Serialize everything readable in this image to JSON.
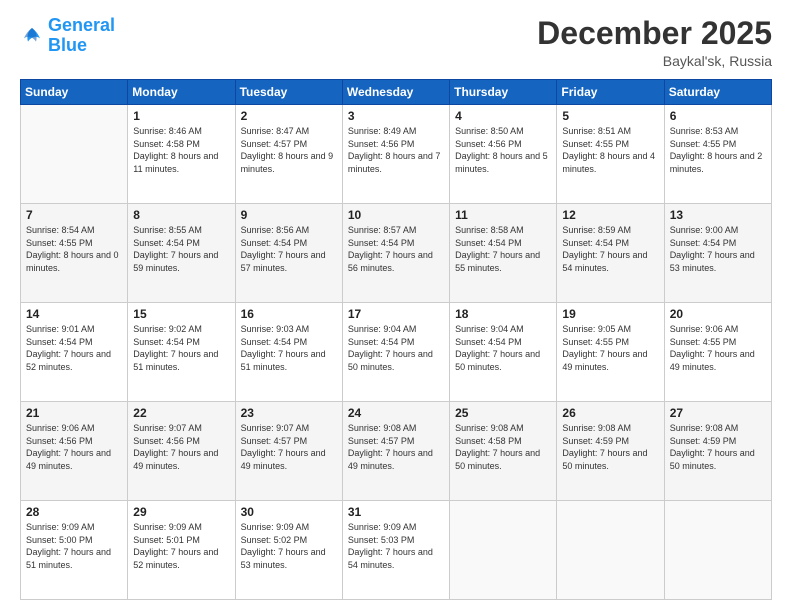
{
  "logo": {
    "line1": "General",
    "line2": "Blue"
  },
  "title": "December 2025",
  "location": "Baykal'sk, Russia",
  "days_of_week": [
    "Sunday",
    "Monday",
    "Tuesday",
    "Wednesday",
    "Thursday",
    "Friday",
    "Saturday"
  ],
  "weeks": [
    [
      {
        "day": "",
        "sunrise": "",
        "sunset": "",
        "daylight": ""
      },
      {
        "day": "1",
        "sunrise": "Sunrise: 8:46 AM",
        "sunset": "Sunset: 4:58 PM",
        "daylight": "Daylight: 8 hours and 11 minutes."
      },
      {
        "day": "2",
        "sunrise": "Sunrise: 8:47 AM",
        "sunset": "Sunset: 4:57 PM",
        "daylight": "Daylight: 8 hours and 9 minutes."
      },
      {
        "day": "3",
        "sunrise": "Sunrise: 8:49 AM",
        "sunset": "Sunset: 4:56 PM",
        "daylight": "Daylight: 8 hours and 7 minutes."
      },
      {
        "day": "4",
        "sunrise": "Sunrise: 8:50 AM",
        "sunset": "Sunset: 4:56 PM",
        "daylight": "Daylight: 8 hours and 5 minutes."
      },
      {
        "day": "5",
        "sunrise": "Sunrise: 8:51 AM",
        "sunset": "Sunset: 4:55 PM",
        "daylight": "Daylight: 8 hours and 4 minutes."
      },
      {
        "day": "6",
        "sunrise": "Sunrise: 8:53 AM",
        "sunset": "Sunset: 4:55 PM",
        "daylight": "Daylight: 8 hours and 2 minutes."
      }
    ],
    [
      {
        "day": "7",
        "sunrise": "Sunrise: 8:54 AM",
        "sunset": "Sunset: 4:55 PM",
        "daylight": "Daylight: 8 hours and 0 minutes."
      },
      {
        "day": "8",
        "sunrise": "Sunrise: 8:55 AM",
        "sunset": "Sunset: 4:54 PM",
        "daylight": "Daylight: 7 hours and 59 minutes."
      },
      {
        "day": "9",
        "sunrise": "Sunrise: 8:56 AM",
        "sunset": "Sunset: 4:54 PM",
        "daylight": "Daylight: 7 hours and 57 minutes."
      },
      {
        "day": "10",
        "sunrise": "Sunrise: 8:57 AM",
        "sunset": "Sunset: 4:54 PM",
        "daylight": "Daylight: 7 hours and 56 minutes."
      },
      {
        "day": "11",
        "sunrise": "Sunrise: 8:58 AM",
        "sunset": "Sunset: 4:54 PM",
        "daylight": "Daylight: 7 hours and 55 minutes."
      },
      {
        "day": "12",
        "sunrise": "Sunrise: 8:59 AM",
        "sunset": "Sunset: 4:54 PM",
        "daylight": "Daylight: 7 hours and 54 minutes."
      },
      {
        "day": "13",
        "sunrise": "Sunrise: 9:00 AM",
        "sunset": "Sunset: 4:54 PM",
        "daylight": "Daylight: 7 hours and 53 minutes."
      }
    ],
    [
      {
        "day": "14",
        "sunrise": "Sunrise: 9:01 AM",
        "sunset": "Sunset: 4:54 PM",
        "daylight": "Daylight: 7 hours and 52 minutes."
      },
      {
        "day": "15",
        "sunrise": "Sunrise: 9:02 AM",
        "sunset": "Sunset: 4:54 PM",
        "daylight": "Daylight: 7 hours and 51 minutes."
      },
      {
        "day": "16",
        "sunrise": "Sunrise: 9:03 AM",
        "sunset": "Sunset: 4:54 PM",
        "daylight": "Daylight: 7 hours and 51 minutes."
      },
      {
        "day": "17",
        "sunrise": "Sunrise: 9:04 AM",
        "sunset": "Sunset: 4:54 PM",
        "daylight": "Daylight: 7 hours and 50 minutes."
      },
      {
        "day": "18",
        "sunrise": "Sunrise: 9:04 AM",
        "sunset": "Sunset: 4:54 PM",
        "daylight": "Daylight: 7 hours and 50 minutes."
      },
      {
        "day": "19",
        "sunrise": "Sunrise: 9:05 AM",
        "sunset": "Sunset: 4:55 PM",
        "daylight": "Daylight: 7 hours and 49 minutes."
      },
      {
        "day": "20",
        "sunrise": "Sunrise: 9:06 AM",
        "sunset": "Sunset: 4:55 PM",
        "daylight": "Daylight: 7 hours and 49 minutes."
      }
    ],
    [
      {
        "day": "21",
        "sunrise": "Sunrise: 9:06 AM",
        "sunset": "Sunset: 4:56 PM",
        "daylight": "Daylight: 7 hours and 49 minutes."
      },
      {
        "day": "22",
        "sunrise": "Sunrise: 9:07 AM",
        "sunset": "Sunset: 4:56 PM",
        "daylight": "Daylight: 7 hours and 49 minutes."
      },
      {
        "day": "23",
        "sunrise": "Sunrise: 9:07 AM",
        "sunset": "Sunset: 4:57 PM",
        "daylight": "Daylight: 7 hours and 49 minutes."
      },
      {
        "day": "24",
        "sunrise": "Sunrise: 9:08 AM",
        "sunset": "Sunset: 4:57 PM",
        "daylight": "Daylight: 7 hours and 49 minutes."
      },
      {
        "day": "25",
        "sunrise": "Sunrise: 9:08 AM",
        "sunset": "Sunset: 4:58 PM",
        "daylight": "Daylight: 7 hours and 50 minutes."
      },
      {
        "day": "26",
        "sunrise": "Sunrise: 9:08 AM",
        "sunset": "Sunset: 4:59 PM",
        "daylight": "Daylight: 7 hours and 50 minutes."
      },
      {
        "day": "27",
        "sunrise": "Sunrise: 9:08 AM",
        "sunset": "Sunset: 4:59 PM",
        "daylight": "Daylight: 7 hours and 50 minutes."
      }
    ],
    [
      {
        "day": "28",
        "sunrise": "Sunrise: 9:09 AM",
        "sunset": "Sunset: 5:00 PM",
        "daylight": "Daylight: 7 hours and 51 minutes."
      },
      {
        "day": "29",
        "sunrise": "Sunrise: 9:09 AM",
        "sunset": "Sunset: 5:01 PM",
        "daylight": "Daylight: 7 hours and 52 minutes."
      },
      {
        "day": "30",
        "sunrise": "Sunrise: 9:09 AM",
        "sunset": "Sunset: 5:02 PM",
        "daylight": "Daylight: 7 hours and 53 minutes."
      },
      {
        "day": "31",
        "sunrise": "Sunrise: 9:09 AM",
        "sunset": "Sunset: 5:03 PM",
        "daylight": "Daylight: 7 hours and 54 minutes."
      },
      {
        "day": "",
        "sunrise": "",
        "sunset": "",
        "daylight": ""
      },
      {
        "day": "",
        "sunrise": "",
        "sunset": "",
        "daylight": ""
      },
      {
        "day": "",
        "sunrise": "",
        "sunset": "",
        "daylight": ""
      }
    ]
  ]
}
